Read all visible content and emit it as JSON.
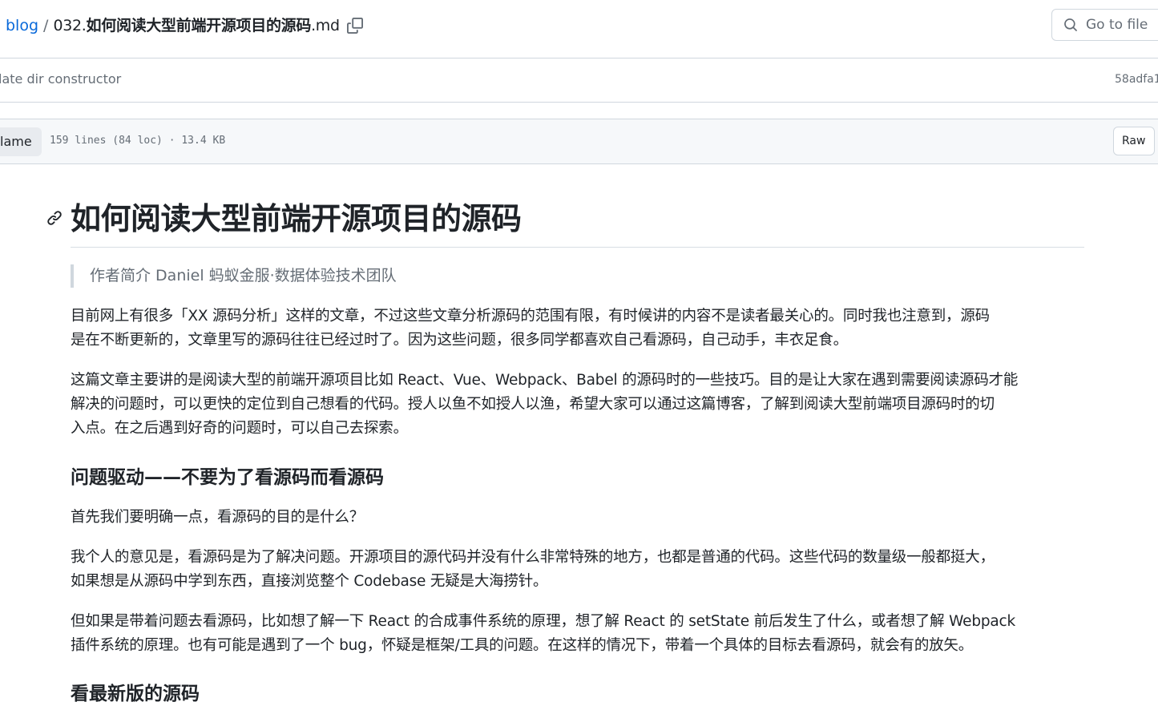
{
  "breadcrumb": {
    "repo": "blog",
    "separator": "/",
    "file_prefix": "032.",
    "file_title": "如何阅读大型前端开源项目的源码",
    "file_ext": ".md"
  },
  "goto_file": {
    "placeholder": "Go to file"
  },
  "commit": {
    "message": "late dir constructor",
    "sha": "58adfa1"
  },
  "toolbar": {
    "blame_label": "lame",
    "file_info": "159 lines (84 loc) · 13.4 KB",
    "raw_label": "Raw"
  },
  "article": {
    "title": "如何阅读大型前端开源项目的源码",
    "quote": "作者简介 Daniel 蚂蚁金服·数据体验技术团队",
    "p1_line1": "目前网上有很多「XX 源码分析」这样的文章，不过这些文章分析源码的范围有限，有时候讲的内容不是读者最关心的。同时我也注意到，源码",
    "p1_line2": "是在不断更新的，文章里写的源码往往已经过时了。因为这些问题，很多同学都喜欢自己看源码，自己动手，丰衣足食。",
    "p2_line1": "这篇文章主要讲的是阅读大型的前端开源项目比如 React、Vue、Webpack、Babel 的源码时的一些技巧。目的是让大家在遇到需要阅读源码才能",
    "p2_line2": "解决的问题时，可以更快的定位到自己想看的代码。授人以鱼不如授人以渔，希望大家可以通过这篇博客，了解到阅读大型前端项目源码时的切",
    "p2_line3": "入点。在之后遇到好奇的问题时，可以自己去探索。",
    "h2_1": "问题驱动——不要为了看源码而看源码",
    "p3": "首先我们要明确一点，看源码的目的是什么？",
    "p4_line1": "我个人的意见是，看源码是为了解决问题。开源项目的源代码并没有什么非常特殊的地方，也都是普通的代码。这些代码的数量级一般都挺大，",
    "p4_line2": "如果想是从源码中学到东西，直接浏览整个 Codebase 无疑是大海捞针。",
    "p5_line1": "但如果是带着问题去看源码，比如想了解一下 React 的合成事件系统的原理，想了解 React 的 setState 前后发生了什么，或者想了解 Webpack",
    "p5_line2": "插件系统的原理。也有可能是遇到了一个 bug，怀疑是框架/工具的问题。在这样的情况下，带着一个具体的目标去看源码，就会有的放矢。",
    "h2_2": "看最新版的源码"
  },
  "colors": {
    "link": "#0969da",
    "text": "#1f2328",
    "muted": "#656d76",
    "border": "#d0d7de",
    "toolbar_bg": "#f6f8fa"
  },
  "icons": [
    "copy-icon",
    "search-icon",
    "link-icon"
  ]
}
